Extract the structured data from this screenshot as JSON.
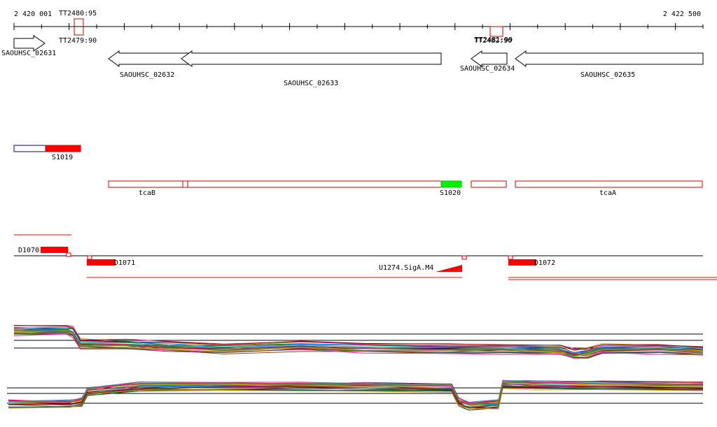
{
  "ruler": {
    "start_label": "2 420 001",
    "end_label": "2 422 500"
  },
  "terminators": [
    {
      "label": "TT2480:95",
      "strand": "top"
    },
    {
      "label": "TT2479:90",
      "strand": "bottom"
    },
    {
      "label": "TT2481:99",
      "strand": "top"
    },
    {
      "label": "TT2482:90",
      "strand": "bottom"
    }
  ],
  "genes": [
    {
      "label": "SAOUHSC_02631",
      "direction": "forward"
    },
    {
      "label": "SAOUHSC_02632",
      "direction": "reverse"
    },
    {
      "label": "SAOUHSC_02633",
      "direction": "reverse"
    },
    {
      "label": "SAOUHSC_02634",
      "direction": "reverse"
    },
    {
      "label": "SAOUHSC_02635",
      "direction": "reverse"
    }
  ],
  "transcripts": [
    {
      "label": "S1019"
    },
    {
      "label": "tcaB"
    },
    {
      "label": "S1020"
    },
    {
      "label": "tcaA"
    }
  ],
  "features": [
    {
      "label": "D1070"
    },
    {
      "label": "D1071"
    },
    {
      "label": "U1274.SigA.M4"
    },
    {
      "label": "D1072"
    }
  ],
  "colors": {
    "gene_outline": "#000000",
    "transcript_outline": "#cc0000",
    "highlight_red": "#ff0000",
    "highlight_green": "#00ee00",
    "outline_blue": "#000099"
  }
}
